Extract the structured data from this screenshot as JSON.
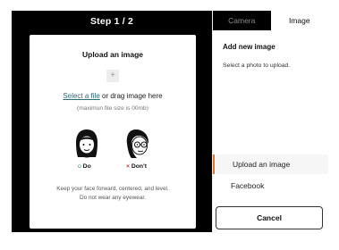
{
  "step": {
    "title": "Step 1 / 2"
  },
  "upload_card": {
    "title": "Upload an image",
    "plus_glyph": "+",
    "select_link": "Select a file",
    "select_rest": " or drag image here",
    "size_note": "(maximun file size is 00mb)",
    "do_mark": "o",
    "do_label": "Do",
    "dont_mark": "×",
    "dont_label": "Don't",
    "hint_line1": "Keep your face forward, centered, and level.",
    "hint_line2": "Do not wear any eyewear."
  },
  "tabs": [
    {
      "label": "Camera",
      "active": false
    },
    {
      "label": "Image",
      "active": true
    }
  ],
  "side_panel": {
    "heading": "Add new image",
    "subtext": "Select a photo to upload.",
    "menu": [
      {
        "label": "Upload an image",
        "active": true
      },
      {
        "label": "Facebook",
        "active": false
      }
    ],
    "cancel_label": "Cancel"
  },
  "colors": {
    "accent": "#e07a2a",
    "do_green": "#2a9a6a",
    "dont_red": "#d03030",
    "link": "#2a6a7a"
  },
  "icons": [
    "plus-icon",
    "face-do-icon",
    "face-dont-eyewear-icon"
  ]
}
